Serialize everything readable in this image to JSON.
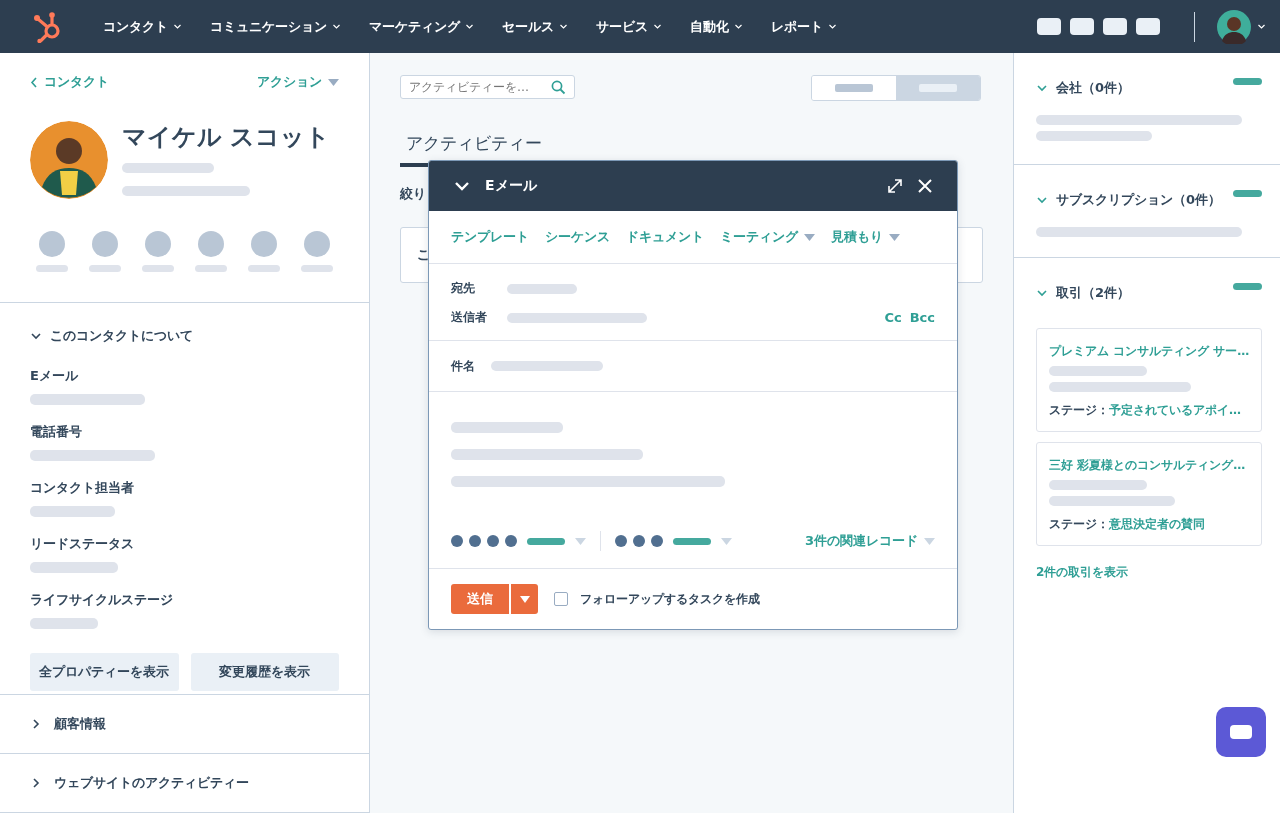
{
  "nav": {
    "menu": [
      "コンタクト",
      "コミュニケーション",
      "マーケティング",
      "セールス",
      "サービス",
      "自動化",
      "レポート"
    ]
  },
  "contact": {
    "back_link": "コンタクト",
    "actions": "アクション",
    "name": "マイケル スコット"
  },
  "about": {
    "title": "このコンタクトについて",
    "expanded": true,
    "properties": [
      "Eメール",
      "電話番号",
      "コンタクト担当者",
      "リードステータス",
      "ライフサイクルステージ"
    ],
    "buttons": [
      "全プロパティーを表示",
      "変更履歴を表示"
    ]
  },
  "collapsed_sections": [
    {
      "title": "顧客情報",
      "expanded": false
    },
    {
      "title": "ウェブサイトのアクティビティー",
      "expanded": false
    }
  ],
  "activity": {
    "search_placeholder": "アクティビティーを…",
    "toggle": [
      {
        "selected": false
      },
      {
        "selected": true
      }
    ],
    "tab": "アクティビティー",
    "filter_label": "絞り",
    "card_text": "こ"
  },
  "email": {
    "title": "Eメール",
    "tools": [
      {
        "label": "テンプレート",
        "dropdown": false
      },
      {
        "label": "シーケンス",
        "dropdown": false
      },
      {
        "label": "ドキュメント",
        "dropdown": false
      },
      {
        "label": "ミーティング",
        "dropdown": true
      },
      {
        "label": "見積もり",
        "dropdown": true
      }
    ],
    "to_label": "宛先",
    "from_label": "送信者",
    "cc": "Cc",
    "bcc": "Bcc",
    "subject_label": "件名",
    "related": "3件の関連レコード",
    "send": "送信",
    "follow_up": {
      "label": "フォローアップするタスクを作成",
      "checked": false
    }
  },
  "sidebar": {
    "sections": [
      {
        "title": "会社（0件）",
        "expanded": true
      },
      {
        "title": "サブスクリプション（0件）",
        "expanded": true
      },
      {
        "title": "取引（2件）",
        "expanded": true
      }
    ],
    "deals": [
      {
        "name": "プレミアム コンサルティング サー…",
        "stage_label": "ステージ：",
        "stage": "予定されているアポイ…"
      },
      {
        "name": "三好 彩夏様とのコンサルティング…",
        "stage_label": "ステージ：",
        "stage": "意思決定者の賛同"
      }
    ],
    "view_all": "2件の取引を表示"
  }
}
